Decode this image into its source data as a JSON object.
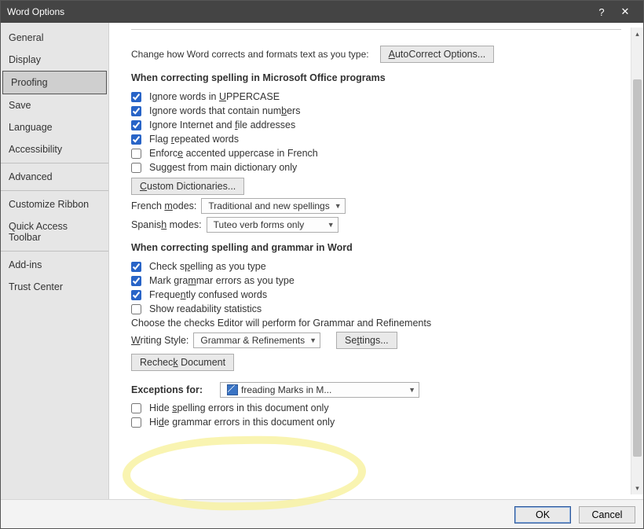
{
  "window": {
    "title": "Word Options",
    "help": "?",
    "close": "✕"
  },
  "sidebar": {
    "groups": [
      [
        "General",
        "Display",
        "Proofing",
        "Save",
        "Language",
        "Accessibility"
      ],
      [
        "Advanced"
      ],
      [
        "Customize Ribbon",
        "Quick Access Toolbar"
      ],
      [
        "Add-ins",
        "Trust Center"
      ]
    ],
    "selected": "Proofing"
  },
  "intro": {
    "text": "Change how Word corrects and formats text as you type:",
    "btn": "AutoCorrect Options..."
  },
  "sec1": {
    "title": "When correcting spelling in Microsoft Office programs",
    "opts": [
      {
        "label": "Ignore words in UPPERCASE",
        "checked": true,
        "u": "U"
      },
      {
        "label": "Ignore words that contain numbers",
        "checked": true,
        "u": "b"
      },
      {
        "label": "Ignore Internet and file addresses",
        "checked": true,
        "u": "f"
      },
      {
        "label": "Flag repeated words",
        "checked": true,
        "u": "r"
      },
      {
        "label": "Enforce accented uppercase in French",
        "checked": false,
        "u": "e"
      },
      {
        "label": "Suggest from main dictionary only",
        "checked": false,
        "u": null
      }
    ],
    "custom_btn": "Custom Dictionaries...",
    "french_label": "French modes:",
    "french_value": "Traditional and new spellings",
    "spanish_label": "Spanish modes:",
    "spanish_value": "Tuteo verb forms only"
  },
  "sec2": {
    "title": "When correcting spelling and grammar in Word",
    "opts": [
      {
        "label": "Check spelling as you type",
        "checked": true,
        "u": "p"
      },
      {
        "label": "Mark grammar errors as you type",
        "checked": true,
        "u": "m"
      },
      {
        "label": "Frequently confused words",
        "checked": true,
        "u": "n"
      },
      {
        "label": "Show readability statistics",
        "checked": false,
        "u": null
      }
    ],
    "choose": "Choose the checks Editor will perform for Grammar and Refinements",
    "ws_label": "Writing Style:",
    "ws_value": "Grammar & Refinements",
    "settings_btn": "Settings...",
    "recheck_btn": "Recheck Document"
  },
  "sec3": {
    "title": "Exceptions for:",
    "doc_value": "freading Marks in M...",
    "opts": [
      {
        "label": "Hide spelling errors in this document only",
        "checked": false,
        "u": "s"
      },
      {
        "label": "Hide grammar errors in this document only",
        "checked": false,
        "u": "d"
      }
    ]
  },
  "footer": {
    "ok": "OK",
    "cancel": "Cancel"
  }
}
